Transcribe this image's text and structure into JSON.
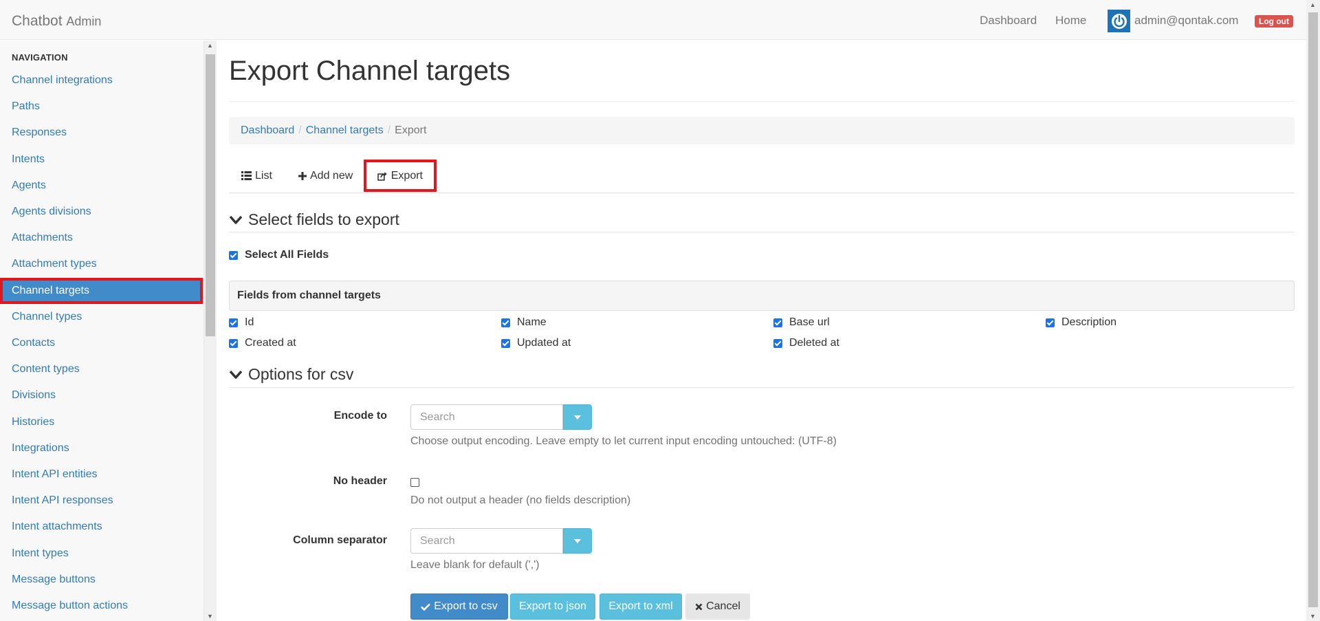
{
  "brand": {
    "title": "Chatbot",
    "subtitle": "Admin"
  },
  "topnav": {
    "dashboard": "Dashboard",
    "home": "Home",
    "user_email": "admin@qontak.com",
    "logout": "Log out"
  },
  "sidebar": {
    "heading": "NAVIGATION",
    "items": [
      {
        "label": "Channel integrations"
      },
      {
        "label": "Paths"
      },
      {
        "label": "Responses"
      },
      {
        "label": "Intents"
      },
      {
        "label": "Agents"
      },
      {
        "label": "Agents divisions"
      },
      {
        "label": "Attachments"
      },
      {
        "label": "Attachment types"
      },
      {
        "label": "Channel targets",
        "active": true
      },
      {
        "label": "Channel types"
      },
      {
        "label": "Contacts"
      },
      {
        "label": "Content types"
      },
      {
        "label": "Divisions"
      },
      {
        "label": "Histories"
      },
      {
        "label": "Integrations"
      },
      {
        "label": "Intent API entities"
      },
      {
        "label": "Intent API responses"
      },
      {
        "label": "Intent attachments"
      },
      {
        "label": "Intent types"
      },
      {
        "label": "Message buttons"
      },
      {
        "label": "Message button actions"
      }
    ]
  },
  "page": {
    "title": "Export Channel targets",
    "breadcrumb": [
      "Dashboard",
      "Channel targets",
      "Export"
    ],
    "tabs": {
      "list": "List",
      "add_new": "Add new",
      "export": "Export"
    }
  },
  "select_fields": {
    "heading": "Select fields to export",
    "select_all": "Select All Fields",
    "panel_title": "Fields from channel targets",
    "fields": [
      "Id",
      "Name",
      "Base url",
      "Description",
      "Created at",
      "Updated at",
      "Deleted at"
    ]
  },
  "csv_options": {
    "heading": "Options for csv",
    "encode_to": {
      "label": "Encode to",
      "placeholder": "Search",
      "help": "Choose output encoding. Leave empty to let current input encoding untouched: (UTF-8)"
    },
    "no_header": {
      "label": "No header",
      "help": "Do not output a header (no fields description)"
    },
    "column_separator": {
      "label": "Column separator",
      "placeholder": "Search",
      "help": "Leave blank for default (',')"
    }
  },
  "actions": {
    "export_csv": "Export to csv",
    "export_json": "Export to json",
    "export_xml": "Export to xml",
    "cancel": "Cancel"
  },
  "colors": {
    "link": "#337ab7",
    "active_nav": "#428bca",
    "highlight_outline": "#e3151d",
    "info": "#5bc0de",
    "danger": "#d9534f"
  }
}
